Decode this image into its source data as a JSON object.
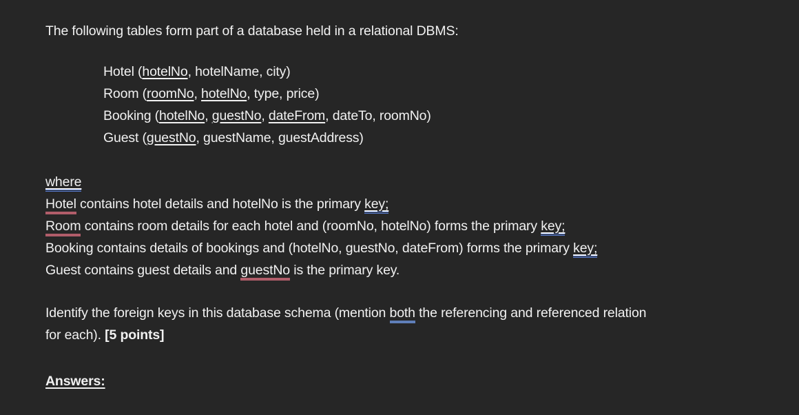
{
  "intro": "The following tables form part of a database held in a relational DBMS:",
  "schema": [
    {
      "relation": "Hotel",
      "attributes": [
        {
          "name": "hotelNo",
          "key": true
        },
        {
          "name": "hotelName",
          "key": false
        },
        {
          "name": "city",
          "key": false
        }
      ]
    },
    {
      "relation": "Room",
      "attributes": [
        {
          "name": "roomNo",
          "key": true
        },
        {
          "name": "hotelNo",
          "key": true
        },
        {
          "name": "type",
          "key": false
        },
        {
          "name": "price",
          "key": false
        }
      ]
    },
    {
      "relation": "Booking",
      "attributes": [
        {
          "name": "hotelNo",
          "key": true
        },
        {
          "name": "guestNo",
          "key": true
        },
        {
          "name": "dateFrom",
          "key": true
        },
        {
          "name": "dateTo",
          "key": false
        },
        {
          "name": "roomNo",
          "key": false
        }
      ]
    },
    {
      "relation": "Guest",
      "attributes": [
        {
          "name": "guestNo",
          "key": true
        },
        {
          "name": "guestName",
          "key": false
        },
        {
          "name": "guestAddress",
          "key": false
        }
      ]
    }
  ],
  "where": {
    "label": "where",
    "lines": [
      {
        "flagged": "Hotel",
        "rest": " contains hotel details and hotelNo is the primary ",
        "tail": "key;"
      },
      {
        "flagged": "Room",
        "rest": " contains room details for each hotel and (roomNo, hotelNo) forms the primary ",
        "tail": "key;"
      },
      {
        "flagged": "",
        "rest": "Booking contains details of bookings and (hotelNo, guestNo, dateFrom) forms the primary ",
        "tail": "key;"
      },
      {
        "pre": "Guest contains guest details and ",
        "flagged": "guestNo",
        "rest": " is the primary key."
      }
    ]
  },
  "question": {
    "line1_pre": "Identify the foreign keys in this database schema (mention ",
    "line1_flag": "both",
    "line1_post": " the referencing and referenced relation",
    "line2_pre": "for each). ",
    "points": "[5 points]"
  },
  "answers_label": "Answers:",
  "colors": {
    "background": "#262626",
    "text": "#f1f1f1",
    "spelling_underline": "#b15d6a",
    "grammar_underline": "#5a7fd6"
  }
}
